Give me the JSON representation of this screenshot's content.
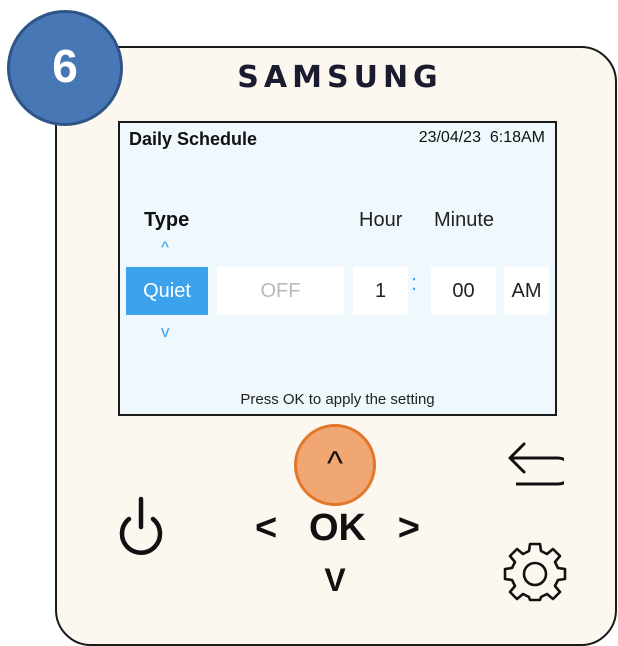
{
  "step": {
    "number": "6"
  },
  "brand": {
    "name": "SAMSUNG"
  },
  "screen": {
    "title": "Daily Schedule",
    "datetime": "23/04/23  6:18AM",
    "columns": {
      "type": "Type",
      "hour": "Hour",
      "minute": "Minute"
    },
    "arrows": {
      "up": "^",
      "down": "v"
    },
    "fields": {
      "type": "Quiet",
      "status": "OFF",
      "hour": "1",
      "separator": ":",
      "minute": "00",
      "ampm": "AM"
    },
    "hint": "Press OK to apply the setting"
  },
  "controls": {
    "up": "^",
    "left": "<",
    "ok": "OK",
    "right": ">",
    "down": "V"
  },
  "icons": {
    "power": "power-icon",
    "back": "back-arrow-icon",
    "settings": "gear-icon"
  },
  "colors": {
    "badge": "#4877b5",
    "selection": "#3ca2ec",
    "up_button": "#f1a774",
    "up_button_border": "#e27629",
    "screen_bg": "#eef8fd",
    "remote_bg": "#fdf8ef"
  }
}
